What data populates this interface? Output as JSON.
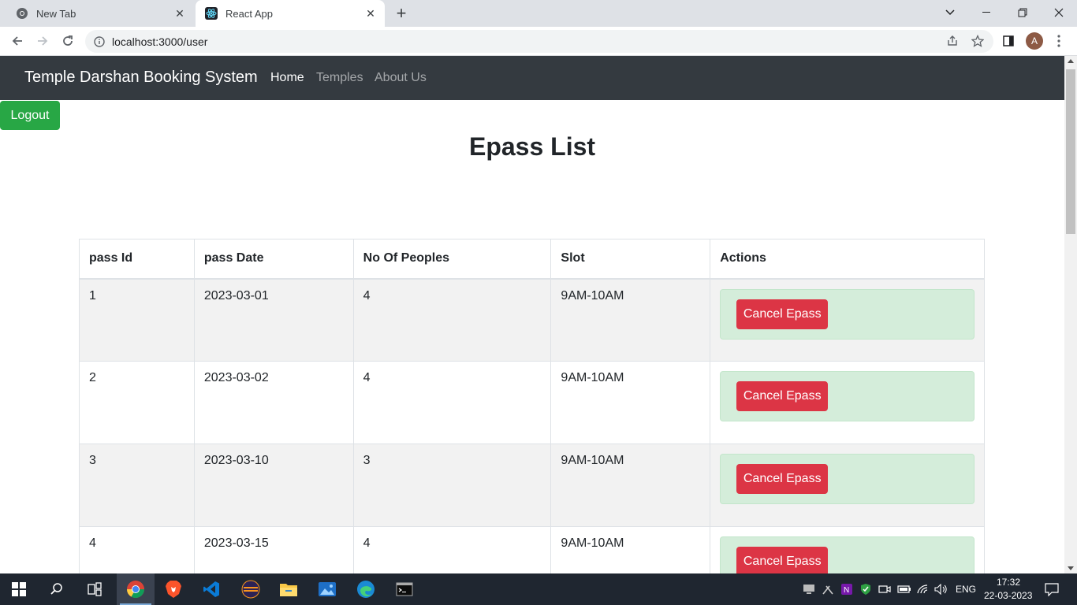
{
  "browser": {
    "tabs": [
      {
        "title": "New Tab",
        "active": false,
        "icon": "chrome-icon"
      },
      {
        "title": "React App",
        "active": true,
        "icon": "react-icon"
      }
    ],
    "url": "localhost:3000/user",
    "profile_initial": "A"
  },
  "navbar": {
    "brand": "Temple Darshan Booking System",
    "links": [
      {
        "label": "Home",
        "active": true
      },
      {
        "label": "Temples",
        "active": false
      },
      {
        "label": "About Us",
        "active": false
      }
    ]
  },
  "logout_label": "Logout",
  "page_title": "Epass List",
  "table": {
    "headers": [
      "pass Id",
      "pass Date",
      "No Of Peoples",
      "Slot",
      "Actions"
    ],
    "rows": [
      {
        "id": "1",
        "date": "2023-03-01",
        "people": "4",
        "slot": "9AM-10AM",
        "action": "Cancel Epass"
      },
      {
        "id": "2",
        "date": "2023-03-02",
        "people": "4",
        "slot": "9AM-10AM",
        "action": "Cancel Epass"
      },
      {
        "id": "3",
        "date": "2023-03-10",
        "people": "3",
        "slot": "9AM-10AM",
        "action": "Cancel Epass"
      },
      {
        "id": "4",
        "date": "2023-03-15",
        "people": "4",
        "slot": "9AM-10AM",
        "action": "Cancel Epass"
      }
    ]
  },
  "taskbar": {
    "apps": [
      "windows-start-icon",
      "search-icon",
      "task-view-icon",
      "chrome-icon",
      "brave-icon",
      "vscode-icon",
      "eclipse-icon",
      "file-explorer-icon",
      "photos-icon",
      "edge-icon",
      "terminal-icon"
    ],
    "language": "ENG",
    "time": "17:32",
    "date": "22-03-2023"
  },
  "colors": {
    "navbar_bg": "#343a40",
    "success": "#28a745",
    "danger": "#dc3545",
    "alert_success_bg": "#d4edda",
    "row_stripe": "#f2f2f2"
  }
}
